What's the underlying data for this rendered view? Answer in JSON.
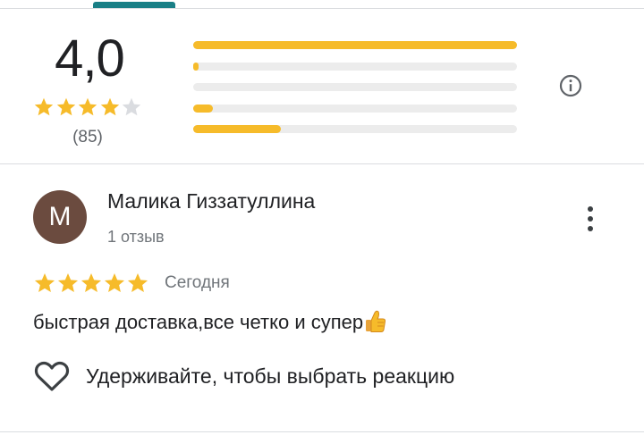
{
  "summary": {
    "score": "4,0",
    "stars_filled": 4,
    "stars_total": 5,
    "count_label": "(85)",
    "distribution": [
      {
        "stars": 5,
        "fraction": 1.0
      },
      {
        "stars": 4,
        "fraction": 0.015
      },
      {
        "stars": 3,
        "fraction": 0.0
      },
      {
        "stars": 2,
        "fraction": 0.06
      },
      {
        "stars": 1,
        "fraction": 0.27
      }
    ]
  },
  "review": {
    "avatar_letter": "M",
    "author": "Малика Гиззатуллина",
    "meta": "1 отзыв",
    "stars": 5,
    "date": "Сегодня",
    "text": "быстрая доставка,все четко и супер"
  },
  "reaction": {
    "label": "Удерживайте, чтобы выбрать реакцию"
  },
  "colors": {
    "star": "#f6bb2a",
    "star_empty": "#dadce0",
    "bar_track": "#ececec",
    "bar_fill": "#f6bb2a",
    "avatar_bg": "#6b4b3f",
    "tab_indicator": "#1a7f86"
  },
  "icons": {
    "info": "info-icon",
    "more": "more-vert-icon",
    "heart": "heart-outline-icon",
    "thumb": "thumbs-up-emoji"
  }
}
